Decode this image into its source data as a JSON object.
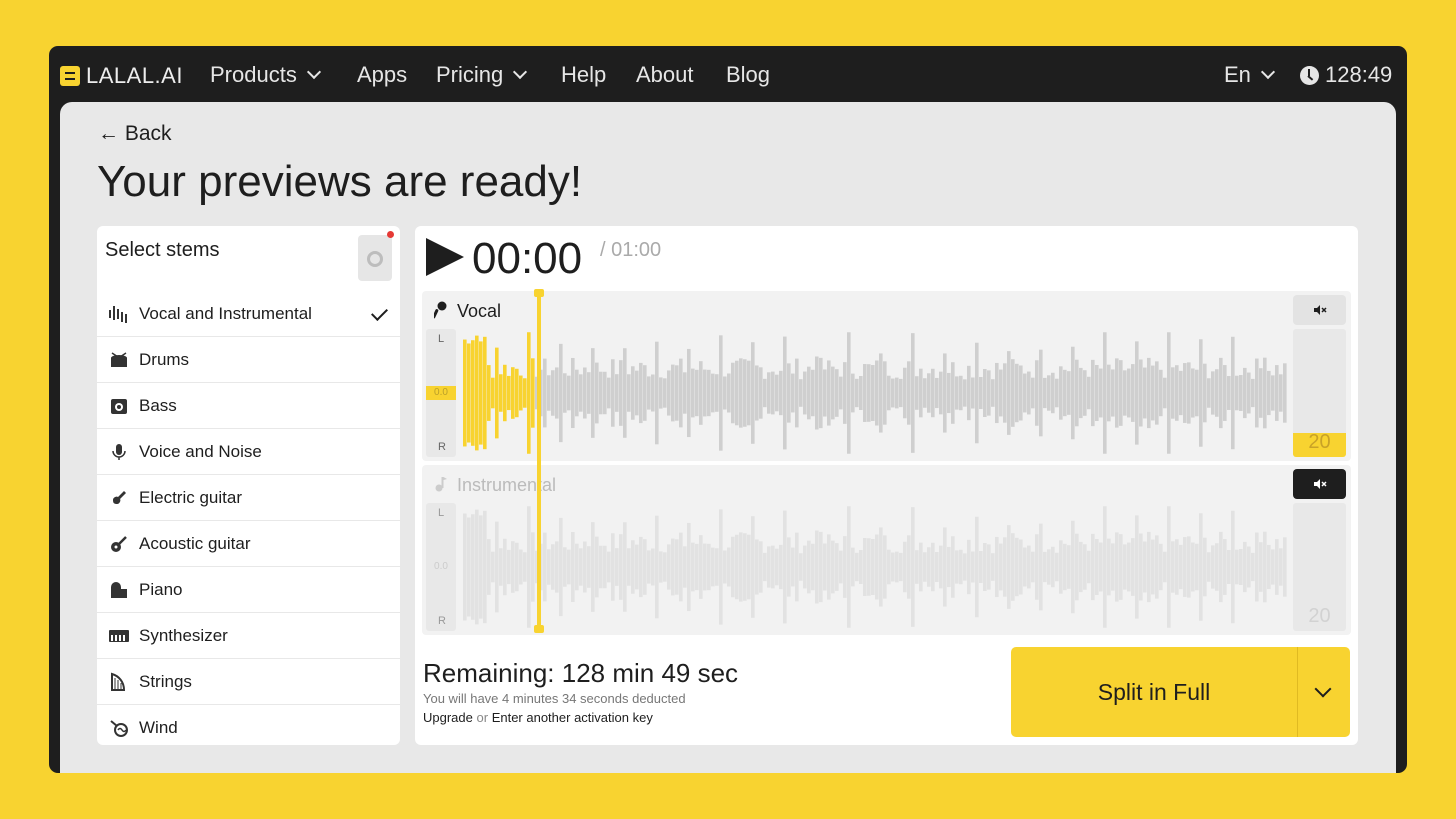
{
  "nav": {
    "logo": "LALAL.AI",
    "items": [
      {
        "label": "Products",
        "dropdown": true
      },
      {
        "label": "Apps",
        "dropdown": false
      },
      {
        "label": "Pricing",
        "dropdown": true
      },
      {
        "label": "Help",
        "dropdown": false
      },
      {
        "label": "About",
        "dropdown": false
      },
      {
        "label": "Blog",
        "dropdown": false
      }
    ],
    "language": "En",
    "time_remaining": "128:49"
  },
  "page": {
    "back_label": "← Back",
    "title": "Your previews are ready!"
  },
  "stems": {
    "title": "Select stems",
    "items": [
      {
        "label": "Vocal and Instrumental",
        "icon": "waveform-icon",
        "selected": true
      },
      {
        "label": "Drums",
        "icon": "drum-icon",
        "selected": false
      },
      {
        "label": "Bass",
        "icon": "bass-amp-icon",
        "selected": false
      },
      {
        "label": "Voice and Noise",
        "icon": "microphone-icon",
        "selected": false
      },
      {
        "label": "Electric guitar",
        "icon": "electric-guitar-icon",
        "selected": false
      },
      {
        "label": "Acoustic guitar",
        "icon": "acoustic-guitar-icon",
        "selected": false
      },
      {
        "label": "Piano",
        "icon": "piano-icon",
        "selected": false
      },
      {
        "label": "Synthesizer",
        "icon": "synthesizer-icon",
        "selected": false
      },
      {
        "label": "Strings",
        "icon": "harp-icon",
        "selected": false
      },
      {
        "label": "Wind",
        "icon": "horn-icon",
        "selected": false
      }
    ]
  },
  "player": {
    "current_time": "00:00",
    "total_time": "/ 01:00",
    "progress": 0.09,
    "tracks": [
      {
        "name": "Vocal",
        "left": "L",
        "right": "R",
        "db": "0.0",
        "volume": "20",
        "volume_level": 0.19,
        "muted": false,
        "active": true
      },
      {
        "name": "Instrumental",
        "left": "L",
        "right": "R",
        "db": "0.0",
        "volume": "20",
        "volume_level": 0.0,
        "muted": true,
        "active": false
      }
    ]
  },
  "footer": {
    "remaining": "Remaining: 128 min 49 sec",
    "deduct_note": "You will have 4 minutes 34 seconds deducted",
    "upgrade": "Upgrade",
    "or": "or",
    "activation": "Enter another activation key",
    "split_button": "Split in Full"
  },
  "colors": {
    "accent": "#F8D330",
    "dark": "#1E1E1E",
    "wave_inactive": "#CFCFCF",
    "wave_muted": "#E2E2E2"
  }
}
